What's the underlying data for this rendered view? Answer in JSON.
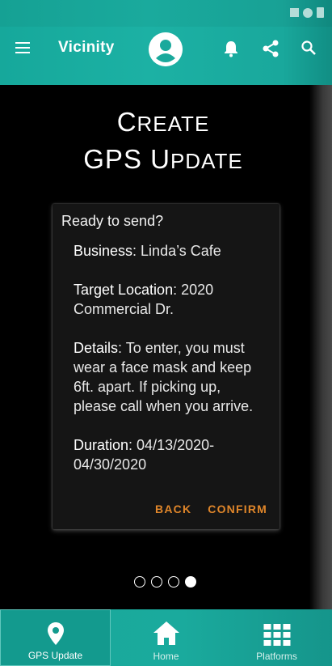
{
  "app": {
    "title": "Vicinity"
  },
  "icons": {
    "menu": "menu-icon",
    "avatar": "account-circle-icon",
    "bell": "bell-icon",
    "share": "share-icon",
    "search": "search-icon"
  },
  "heading": {
    "line1_first": "C",
    "line1_rest": "REATE",
    "line2_first": "GPS U",
    "line2_rest": "PDATE"
  },
  "card": {
    "title": "Ready to send?",
    "fields": [
      {
        "label": "Business",
        "value": ": Linda’s Cafe"
      },
      {
        "label": "Target Location",
        "value": ": 2020 Commercial Dr."
      },
      {
        "label": "Details",
        "value": ": To enter, you must wear a face mask and keep 6ft. apart. If picking up, please call when you arrive."
      },
      {
        "label": "Duration",
        "value": ": 04/13/2020-04/30/2020"
      }
    ],
    "back_label": "BACK",
    "confirm_label": "CONFIRM"
  },
  "pager": {
    "count": 4,
    "active_index": 3
  },
  "bottom_nav": [
    {
      "label": "GPS Update",
      "icon": "location-pin-icon",
      "selected": true
    },
    {
      "label": "Home",
      "icon": "home-icon",
      "selected": false
    },
    {
      "label": "Platforms",
      "icon": "grid-icon",
      "selected": false
    }
  ],
  "colors": {
    "accent": "#1aa99c",
    "action": "#e0862a",
    "background": "#000000"
  }
}
